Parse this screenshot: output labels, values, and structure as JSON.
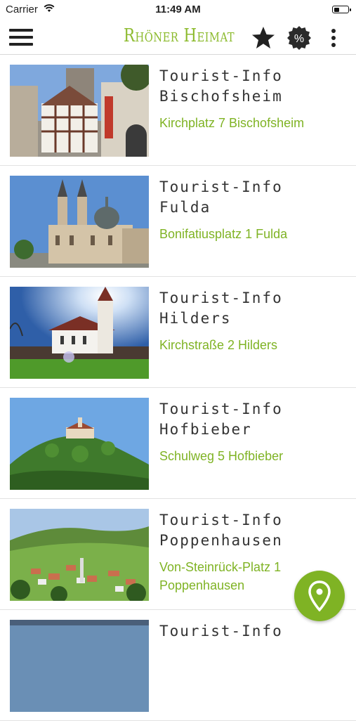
{
  "status_bar": {
    "carrier": "Carrier",
    "time": "11:49 AM"
  },
  "header": {
    "title": "Rhöner Heimat",
    "menu_icon": "hamburger-icon",
    "favorites_icon": "star-icon",
    "deals_icon": "percent-badge-icon",
    "more_icon": "more-vertical-icon",
    "deals_label": "%"
  },
  "colors": {
    "accent": "#7fb324",
    "title_text": "#333333"
  },
  "items": [
    {
      "title": "Tourist-Info\nBischofsheim",
      "address": "Kirchplatz 7 Bischofsheim",
      "image": "half-timbered town hall with tower"
    },
    {
      "title": "Tourist-Info\nFulda",
      "address": "Bonifatiusplatz 1 Fulda",
      "image": "baroque cathedral with twin towers"
    },
    {
      "title": "Tourist-Info\nHilders",
      "address": "Kirchstraße 2 Hilders",
      "image": "white church with steeple"
    },
    {
      "title": "Tourist-Info\nHofbieber",
      "address": "Schulweg 5 Hofbieber",
      "image": "castle on wooded hill"
    },
    {
      "title": "Tourist-Info\nPoppenhausen",
      "address": "Von-Steinrück-Platz 1 Poppenhausen",
      "image": "village in green valley"
    },
    {
      "title": "Tourist-Info",
      "address": "",
      "image": "partially visible photo"
    }
  ],
  "fab": {
    "icon": "map-pin-icon"
  }
}
